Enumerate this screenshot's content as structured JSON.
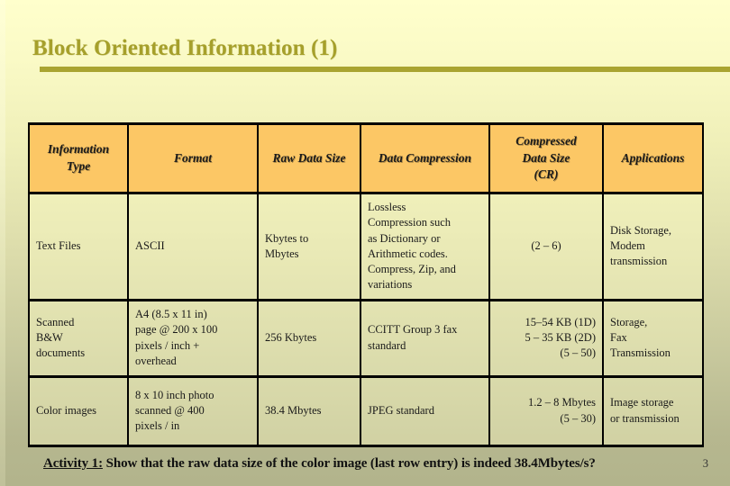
{
  "slide": {
    "title": "Block Oriented Information (1)",
    "page_number": "3",
    "accent_color": "#A9A431",
    "title_color": "#A6A02B",
    "header_bg": "#FCC765",
    "bg_top": "#FFFFCC",
    "bg_bottom": "#B2B48C"
  },
  "table": {
    "headers": [
      "Information Type",
      "Format",
      "Raw Data Size",
      "Data Compression",
      "Compressed Data Size (CR)",
      "Applications"
    ],
    "header_lines": {
      "col0": [
        "Information",
        "Type"
      ],
      "col1": [
        "Format"
      ],
      "col2": [
        "Raw Data Size"
      ],
      "col3": [
        "Data Compression"
      ],
      "col4": [
        "Compressed",
        "Data Size",
        "(CR)"
      ],
      "col5": [
        "Applications"
      ]
    },
    "rows": [
      {
        "type": "Text Files",
        "format": "ASCII",
        "raw_size_lines": [
          "Kbytes to",
          "Mbytes"
        ],
        "compression_lines": [
          "Lossless",
          "Compression such",
          "as Dictionary or",
          "Arithmetic codes.",
          "Compress, Zip, and",
          "variations"
        ],
        "compressed_size_lines": [
          "(2 – 6)"
        ],
        "applications_lines": [
          "Disk Storage,",
          "Modem",
          "transmission"
        ]
      },
      {
        "type_lines": [
          "Scanned",
          "B&W",
          "documents"
        ],
        "format_lines": [
          "A4 (8.5 x 11 in)",
          "page @ 200 x 100",
          "pixels / inch +",
          "overhead"
        ],
        "raw_size_lines": [
          "256 Kbytes"
        ],
        "compression_lines": [
          "CCITT Group 3 fax",
          "standard"
        ],
        "compressed_size_lines": [
          "15–54 KB (1D)",
          "5 – 35 KB (2D)",
          "(5 – 50)"
        ],
        "applications_lines": [
          "Storage,",
          "Fax",
          "Transmission"
        ]
      },
      {
        "type_lines": [
          "Color images"
        ],
        "format_lines": [
          "8 x 10 inch photo",
          "scanned @ 400",
          "pixels / in"
        ],
        "raw_size_lines": [
          "38.4 Mbytes"
        ],
        "compression_lines": [
          "JPEG standard"
        ],
        "compressed_size_lines": [
          "1.2 – 8 Mbytes",
          "(5 – 30)"
        ],
        "applications_lines": [
          "Image storage",
          "or transmission"
        ]
      }
    ]
  },
  "footer": {
    "activity_label": "Activity 1:",
    "activity_text": " Show that the raw data size of the color image (last row entry) is indeed 38.4Mbytes/s?"
  }
}
